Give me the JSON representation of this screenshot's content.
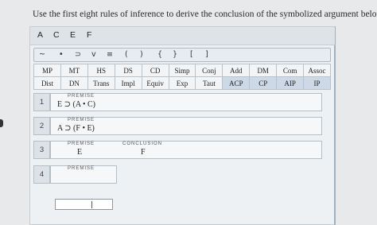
{
  "instructions": "Use the first eight rules of inference to derive the conclusion of the symbolized argument below.",
  "letters": [
    "A",
    "C",
    "E",
    "F"
  ],
  "symbols": [
    "~",
    "•",
    "⊃",
    "v",
    "≡",
    "(",
    ")",
    "{",
    "}",
    "[",
    "]"
  ],
  "rules": [
    [
      "MP",
      "MT",
      "HS",
      "DS",
      "CD",
      "Simp",
      "Conj",
      "Add",
      "DM",
      "Com",
      "Assoc"
    ],
    [
      "Dist",
      "DN",
      "Trans",
      "Impl",
      "Equiv",
      "Exp",
      "Taut",
      "ACP",
      "CP",
      "AIP",
      "IP"
    ]
  ],
  "steps": [
    {
      "number": "1",
      "tag": "PREMISE",
      "expression": "E ⊃ (A • C)"
    },
    {
      "number": "2",
      "tag": "PREMISE",
      "expression": "A ⊃ (F • E)"
    },
    {
      "number": "3",
      "tag": "PREMISE",
      "expression": "E",
      "conclusion_tag": "CONCLUSION",
      "conclusion": "F"
    },
    {
      "number": "4",
      "tag": "PREMISE",
      "expression": ""
    }
  ]
}
